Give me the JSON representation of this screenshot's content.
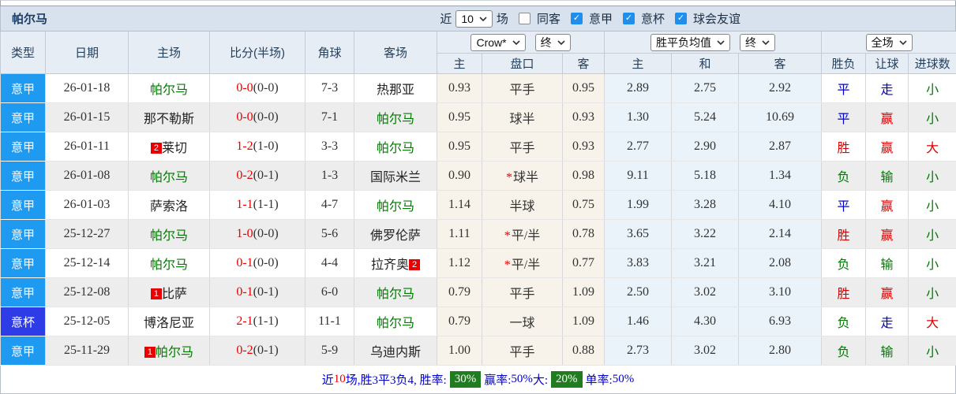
{
  "title": "帕尔马",
  "colors": {
    "red": "#d80000",
    "blue": "#0000cc",
    "green": "#007a00",
    "score_red": "#e80000",
    "badge_serie_a": "#1e9af0",
    "badge_coppa": "#2e3ce8",
    "checkbox_blue": "#1e8fef",
    "pct_green": "#1f7d1f",
    "handicap_col_bg": "#f8f3ea",
    "odds_col_bg": "#e9f3f9"
  },
  "filter_bar": {
    "near_label": "近",
    "count_select_value": "10",
    "games_label": "场",
    "checkboxes": [
      {
        "label": "同客",
        "checked": false
      },
      {
        "label": "意甲",
        "checked": true
      },
      {
        "label": "意杯",
        "checked": true
      },
      {
        "label": "球会友谊",
        "checked": true
      }
    ]
  },
  "table": {
    "main_headers": [
      "类型",
      "日期",
      "主场",
      "比分(半场)",
      "角球",
      "客场"
    ],
    "selects": {
      "bookmaker": "Crow*",
      "handicap_time": "终",
      "odds_avg": "胜平负均值",
      "odds_time": "终",
      "scope": "全场"
    },
    "sub_headers": [
      "主",
      "盘口",
      "客",
      "主",
      "和",
      "客",
      "胜负",
      "让球",
      "进球数"
    ],
    "rows": [
      {
        "league": "意甲",
        "league_cls": "serie",
        "date": "26-01-18",
        "home": {
          "name": "帕尔马",
          "cls": "green"
        },
        "score_ft": "0-0",
        "score_ht": "(0-0)",
        "corners": "7-3",
        "away": {
          "name": "热那亚",
          "cls": "dark"
        },
        "ah_home": "0.93",
        "ah_star": false,
        "ah_line": "平手",
        "ah_away": "0.95",
        "odds_home": "2.89",
        "odds_draw": "2.75",
        "odds_away": "2.92",
        "result": {
          "t": "平",
          "cls": "blue"
        },
        "ah_result": {
          "t": "走",
          "cls": "blue"
        },
        "goals": {
          "t": "小",
          "cls": "green"
        }
      },
      {
        "league": "意甲",
        "league_cls": "serie",
        "date": "26-01-15",
        "home": {
          "name": "那不勒斯",
          "cls": "dark"
        },
        "score_ft": "0-0",
        "score_ht": "(0-0)",
        "corners": "7-1",
        "away": {
          "name": "帕尔马",
          "cls": "green"
        },
        "ah_home": "0.95",
        "ah_star": false,
        "ah_line": "球半",
        "ah_away": "0.93",
        "odds_home": "1.30",
        "odds_draw": "5.24",
        "odds_away": "10.69",
        "result": {
          "t": "平",
          "cls": "blue"
        },
        "ah_result": {
          "t": "赢",
          "cls": "red"
        },
        "goals": {
          "t": "小",
          "cls": "green"
        }
      },
      {
        "league": "意甲",
        "league_cls": "serie",
        "date": "26-01-11",
        "home": {
          "name": "莱切",
          "cls": "dark",
          "badge": "2",
          "badge_side": "left"
        },
        "score_ft": "1-2",
        "score_ht": "(1-0)",
        "corners": "3-3",
        "away": {
          "name": "帕尔马",
          "cls": "green"
        },
        "ah_home": "0.95",
        "ah_star": false,
        "ah_line": "平手",
        "ah_away": "0.93",
        "odds_home": "2.77",
        "odds_draw": "2.90",
        "odds_away": "2.87",
        "result": {
          "t": "胜",
          "cls": "red"
        },
        "ah_result": {
          "t": "赢",
          "cls": "red"
        },
        "goals": {
          "t": "大",
          "cls": "red"
        }
      },
      {
        "league": "意甲",
        "league_cls": "serie",
        "date": "26-01-08",
        "home": {
          "name": "帕尔马",
          "cls": "green"
        },
        "score_ft": "0-2",
        "score_ht": "(0-1)",
        "corners": "1-3",
        "away": {
          "name": "国际米兰",
          "cls": "dark"
        },
        "ah_home": "0.90",
        "ah_star": true,
        "ah_line": "球半",
        "ah_away": "0.98",
        "odds_home": "9.11",
        "odds_draw": "5.18",
        "odds_away": "1.34",
        "result": {
          "t": "负",
          "cls": "green"
        },
        "ah_result": {
          "t": "输",
          "cls": "green"
        },
        "goals": {
          "t": "小",
          "cls": "green"
        }
      },
      {
        "league": "意甲",
        "league_cls": "serie",
        "date": "26-01-03",
        "home": {
          "name": "萨索洛",
          "cls": "dark"
        },
        "score_ft": "1-1",
        "score_ht": "(1-1)",
        "corners": "4-7",
        "away": {
          "name": "帕尔马",
          "cls": "green"
        },
        "ah_home": "1.14",
        "ah_star": false,
        "ah_line": "半球",
        "ah_away": "0.75",
        "odds_home": "1.99",
        "odds_draw": "3.28",
        "odds_away": "4.10",
        "result": {
          "t": "平",
          "cls": "blue"
        },
        "ah_result": {
          "t": "赢",
          "cls": "red"
        },
        "goals": {
          "t": "小",
          "cls": "green"
        }
      },
      {
        "league": "意甲",
        "league_cls": "serie",
        "date": "25-12-27",
        "home": {
          "name": "帕尔马",
          "cls": "green"
        },
        "score_ft": "1-0",
        "score_ht": "(0-0)",
        "corners": "5-6",
        "away": {
          "name": "佛罗伦萨",
          "cls": "dark"
        },
        "ah_home": "1.11",
        "ah_star": true,
        "ah_line": "平/半",
        "ah_away": "0.78",
        "odds_home": "3.65",
        "odds_draw": "3.22",
        "odds_away": "2.14",
        "result": {
          "t": "胜",
          "cls": "red"
        },
        "ah_result": {
          "t": "赢",
          "cls": "red"
        },
        "goals": {
          "t": "小",
          "cls": "green"
        }
      },
      {
        "league": "意甲",
        "league_cls": "serie",
        "date": "25-12-14",
        "home": {
          "name": "帕尔马",
          "cls": "green"
        },
        "score_ft": "0-1",
        "score_ht": "(0-0)",
        "corners": "4-4",
        "away": {
          "name": "拉齐奥",
          "cls": "dark",
          "badge": "2",
          "badge_side": "right"
        },
        "ah_home": "1.12",
        "ah_star": true,
        "ah_line": "平/半",
        "ah_away": "0.77",
        "odds_home": "3.83",
        "odds_draw": "3.21",
        "odds_away": "2.08",
        "result": {
          "t": "负",
          "cls": "green"
        },
        "ah_result": {
          "t": "输",
          "cls": "green"
        },
        "goals": {
          "t": "小",
          "cls": "green"
        }
      },
      {
        "league": "意甲",
        "league_cls": "serie",
        "date": "25-12-08",
        "home": {
          "name": "比萨",
          "cls": "dark",
          "badge": "1",
          "badge_side": "left"
        },
        "score_ft": "0-1",
        "score_ht": "(0-1)",
        "corners": "6-0",
        "away": {
          "name": "帕尔马",
          "cls": "green"
        },
        "ah_home": "0.79",
        "ah_star": false,
        "ah_line": "平手",
        "ah_away": "1.09",
        "odds_home": "2.50",
        "odds_draw": "3.02",
        "odds_away": "3.10",
        "result": {
          "t": "胜",
          "cls": "red"
        },
        "ah_result": {
          "t": "赢",
          "cls": "red"
        },
        "goals": {
          "t": "小",
          "cls": "green"
        }
      },
      {
        "league": "意杯",
        "league_cls": "coppa",
        "date": "25-12-05",
        "home": {
          "name": "博洛尼亚",
          "cls": "dark"
        },
        "score_ft": "2-1",
        "score_ht": "(1-1)",
        "corners": "11-1",
        "away": {
          "name": "帕尔马",
          "cls": "green"
        },
        "ah_home": "0.79",
        "ah_star": false,
        "ah_line": "一球",
        "ah_away": "1.09",
        "odds_home": "1.46",
        "odds_draw": "4.30",
        "odds_away": "6.93",
        "result": {
          "t": "负",
          "cls": "green"
        },
        "ah_result": {
          "t": "走",
          "cls": "blue"
        },
        "goals": {
          "t": "大",
          "cls": "red"
        }
      },
      {
        "league": "意甲",
        "league_cls": "serie",
        "date": "25-11-29",
        "home": {
          "name": "帕尔马",
          "cls": "green",
          "badge": "1",
          "badge_side": "left"
        },
        "score_ft": "0-2",
        "score_ht": "(0-1)",
        "corners": "5-9",
        "away": {
          "name": "乌迪内斯",
          "cls": "dark"
        },
        "ah_home": "1.00",
        "ah_star": false,
        "ah_line": "平手",
        "ah_away": "0.88",
        "odds_home": "2.73",
        "odds_draw": "3.02",
        "odds_away": "2.80",
        "result": {
          "t": "负",
          "cls": "green"
        },
        "ah_result": {
          "t": "输",
          "cls": "green"
        },
        "goals": {
          "t": "小",
          "cls": "green"
        }
      }
    ]
  },
  "footer": {
    "parts": [
      {
        "t": "近"
      },
      {
        "t": "10"
      },
      {
        "t": "场,胜3平3负4, 胜率: "
      },
      {
        "t": "30%"
      },
      {
        "t": " 赢率:"
      },
      {
        "t": "50%"
      },
      {
        "t": " 大: "
      },
      {
        "t": "20%"
      },
      {
        "t": " 单率:"
      },
      {
        "t": "50%"
      }
    ]
  }
}
